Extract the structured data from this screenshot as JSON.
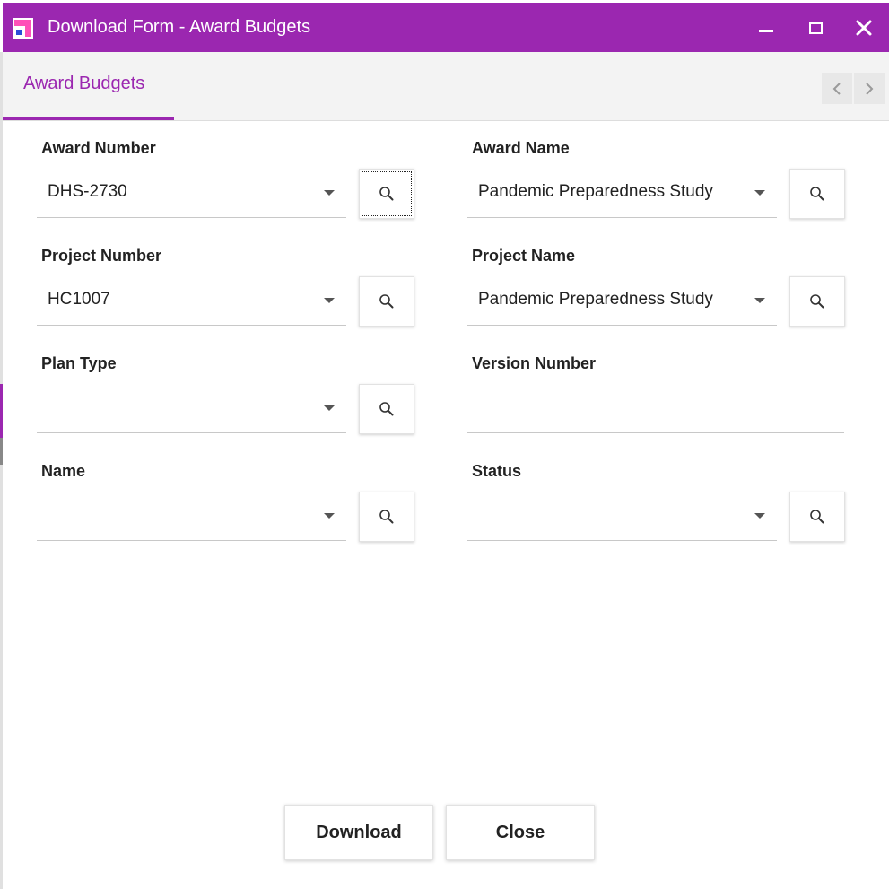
{
  "window": {
    "title": "Download Form - Award Budgets"
  },
  "tabs": [
    {
      "label": "Award Budgets",
      "active": true
    }
  ],
  "form": {
    "award_number": {
      "label": "Award Number",
      "value": "DHS-2730"
    },
    "award_name": {
      "label": "Award Name",
      "value": "Pandemic Preparedness Study"
    },
    "project_number": {
      "label": "Project Number",
      "value": "HC1007"
    },
    "project_name": {
      "label": "Project Name",
      "value": "Pandemic Preparedness Study"
    },
    "plan_type": {
      "label": "Plan Type",
      "value": ""
    },
    "version_number": {
      "label": "Version Number",
      "value": ""
    },
    "name": {
      "label": "Name",
      "value": ""
    },
    "status": {
      "label": "Status",
      "value": ""
    }
  },
  "footer": {
    "download_label": "Download",
    "close_label": "Close"
  },
  "colors": {
    "accent": "#9b27b0",
    "tab_strip": "#f3f3f3"
  }
}
